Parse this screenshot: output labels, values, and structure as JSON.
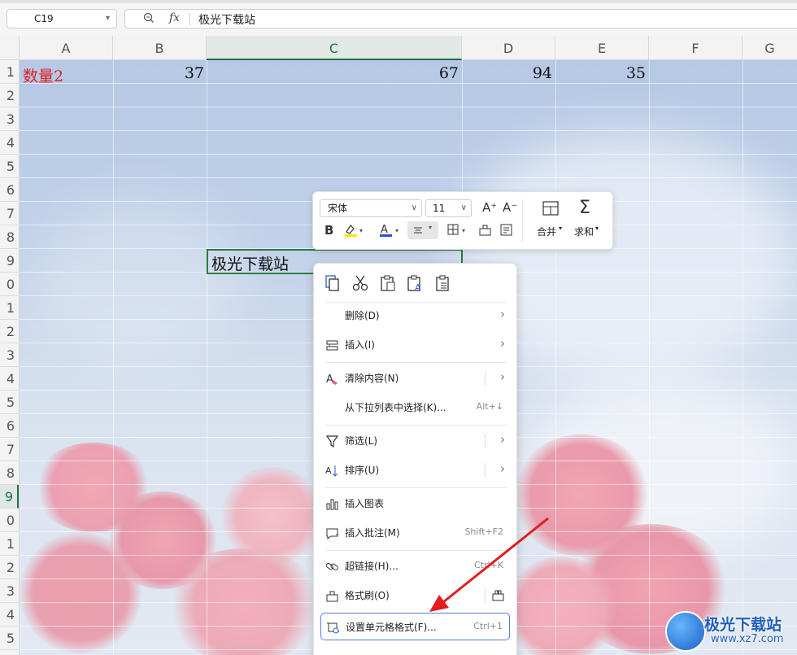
{
  "name_box": {
    "value": "C19"
  },
  "formula_bar": {
    "fx_label": "fx",
    "value": "极光下载站"
  },
  "columns": [
    "A",
    "B",
    "C",
    "D",
    "E",
    "F",
    "G"
  ],
  "selected_column": "C",
  "rows": [
    "1",
    "2",
    "3",
    "4",
    "5",
    "6",
    "7",
    "8",
    "9",
    "0",
    "1",
    "2",
    "3",
    "4",
    "5",
    "6",
    "7",
    "8",
    "9",
    "0",
    "1",
    "2",
    "3",
    "4",
    "5"
  ],
  "selected_row_label": "9",
  "cells": {
    "a1": "数量2",
    "b1": "37",
    "c1": "67",
    "d1": "94",
    "e1": "35",
    "c19": "极光下载站"
  },
  "mini_toolbar": {
    "font_name": "宋体",
    "font_size": "11",
    "increase_font": "A⁺",
    "decrease_font": "A⁻",
    "bold": "B",
    "merge_label": "合并",
    "sum_label": "求和"
  },
  "context_menu": {
    "items": [
      {
        "label": "删除(D)",
        "shortcut": "",
        "submenu": true
      },
      {
        "label": "插入(I)",
        "shortcut": "",
        "submenu": true
      },
      {
        "label": "清除内容(N)",
        "shortcut": "",
        "submenu": true
      },
      {
        "label": "从下拉列表中选择(K)...",
        "shortcut": "Alt+↓",
        "submenu": false
      },
      {
        "label": "筛选(L)",
        "shortcut": "",
        "submenu": true
      },
      {
        "label": "排序(U)",
        "shortcut": "",
        "submenu": true
      },
      {
        "label": "插入图表",
        "shortcut": "",
        "submenu": false
      },
      {
        "label": "插入批注(M)",
        "shortcut": "Shift+F2",
        "submenu": false
      },
      {
        "label": "超链接(H)...",
        "shortcut": "Ctrl+K",
        "submenu": false
      },
      {
        "label": "格式刷(O)",
        "shortcut": "",
        "submenu": false
      },
      {
        "label": "设置单元格格式(F)...",
        "shortcut": "Ctrl+1",
        "submenu": false
      }
    ]
  },
  "watermark": {
    "title": "极光下载站",
    "url": "www.xz7.com"
  },
  "colors": {
    "selection_green": "#2d7a3e",
    "highlight_blue": "#4f7fd8",
    "arrow_red": "#e11d1d"
  }
}
